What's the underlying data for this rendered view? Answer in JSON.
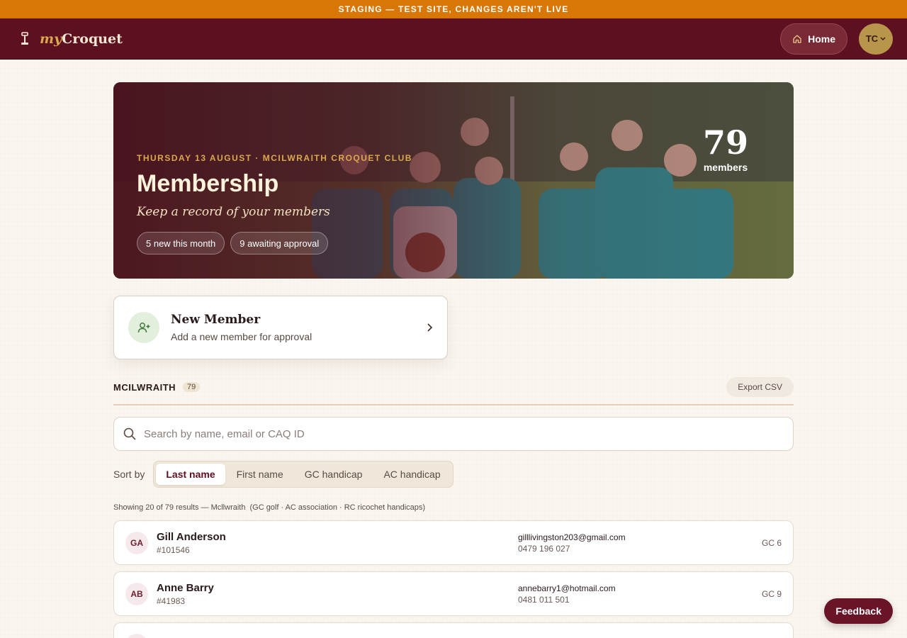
{
  "banner": {
    "text": "STAGING — TEST SITE, CHANGES AREN'T LIVE"
  },
  "brand": {
    "my": "my",
    "name": "Croquet"
  },
  "nav": {
    "home_label": "Home",
    "avatar_initials": "TC"
  },
  "hero": {
    "date_line": "THURSDAY 13 AUGUST · MCILWRAITH CROQUET CLUB",
    "title": "Membership",
    "subtitle": "Keep a record of your members",
    "pills": [
      "5 new this month",
      "9 awaiting approval"
    ],
    "count": "79",
    "count_label": "members"
  },
  "new_member": {
    "title": "New Member",
    "subtitle": "Add a new member for approval"
  },
  "club": {
    "name": "MCILWRAITH",
    "count": "79",
    "export_label": "Export CSV"
  },
  "search": {
    "placeholder": "Search by name, email or CAQ ID",
    "value": ""
  },
  "sort": {
    "label": "Sort by",
    "options": [
      "Last name",
      "First name",
      "GC handicap",
      "AC handicap"
    ],
    "selected": "Last name"
  },
  "results": {
    "summary": "Showing 20 of 79 results — Mcllwraith",
    "hint": "(GC golf · AC association · RC ricochet handicaps)"
  },
  "members": [
    {
      "initials": "GA",
      "name": "Gill Anderson",
      "id": "#101546",
      "email": "gilllivingston203@gmail.com",
      "phone": "0479 196 027",
      "handicap": "GC 6"
    },
    {
      "initials": "AB",
      "name": "Anne Barry",
      "id": "#41983",
      "email": "annebarry1@hotmail.com",
      "phone": "0481 011 501",
      "handicap": "GC 9"
    },
    {
      "initials": "",
      "name": "",
      "id": "",
      "email": "",
      "phone": "",
      "handicap": ""
    }
  ],
  "feedback": {
    "label": "Feedback"
  },
  "colors": {
    "brand": "#5c1020",
    "accent": "#d9a84e",
    "staging": "#d97706"
  }
}
